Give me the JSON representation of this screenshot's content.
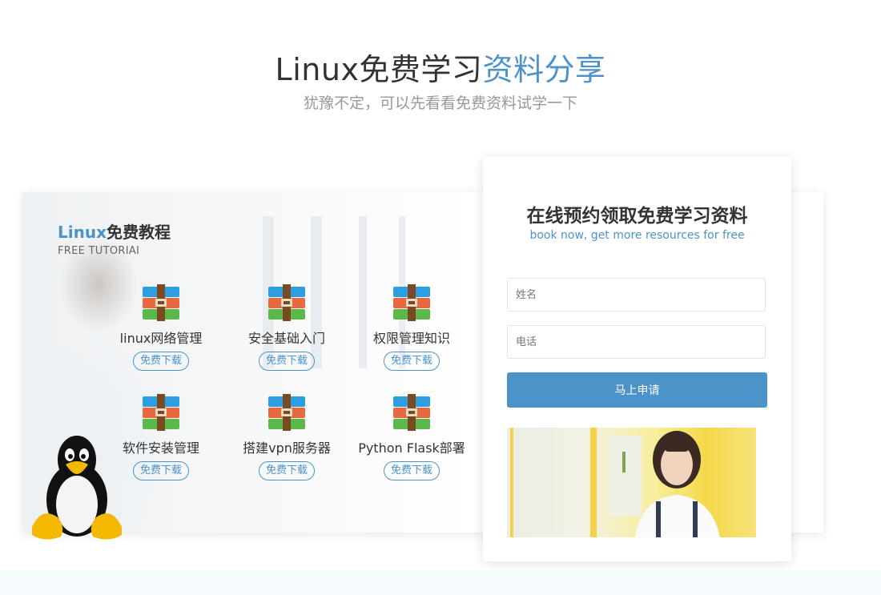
{
  "section": {
    "title_main": "Linux免费学习",
    "title_accent": "资料分享",
    "subtitle": "犹豫不定，可以先看看免费资料试学一下"
  },
  "tutorial": {
    "title_accent": "Linux",
    "title_rest": "免费教程",
    "subtitle": "FREE TUTORIAI",
    "items": [
      {
        "name": "linux网络管理",
        "button": "免费下载"
      },
      {
        "name": "安全基础入门",
        "button": "免费下载"
      },
      {
        "name": "权限管理知识",
        "button": "免费下载"
      },
      {
        "name": "软件安装管理",
        "button": "免费下载"
      },
      {
        "name": "搭建vpn服务器",
        "button": "免费下载"
      },
      {
        "name": "Python Flask部署",
        "button": "免费下载"
      }
    ]
  },
  "form": {
    "title": "在线预约领取免费学习资料",
    "subtitle": "book now, get more resources for free",
    "name_placeholder": "姓名",
    "phone_placeholder": "电话",
    "submit_label": "马上申请"
  },
  "colors": {
    "accent": "#4b93c9",
    "text": "#333333",
    "muted": "#999999"
  }
}
